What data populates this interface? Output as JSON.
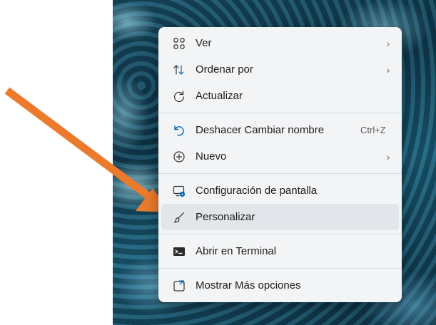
{
  "menu": {
    "items": [
      {
        "label": "Ver",
        "icon": "grid-icon",
        "submenu": true
      },
      {
        "label": "Ordenar por",
        "icon": "sort-icon",
        "submenu": true
      },
      {
        "label": "Actualizar",
        "icon": "refresh-icon"
      },
      {
        "label": "Deshacer Cambiar nombre",
        "icon": "undo-icon",
        "shortcut": "Ctrl+Z"
      },
      {
        "label": "Nuevo",
        "icon": "new-icon",
        "submenu": true
      },
      {
        "label": "Configuración de pantalla",
        "icon": "display-settings-icon"
      },
      {
        "label": "Personalizar",
        "icon": "brush-icon",
        "highlighted": true
      },
      {
        "label": "Abrir en Terminal",
        "icon": "terminal-icon"
      },
      {
        "label": "Mostrar Más opciones",
        "icon": "more-options-icon"
      }
    ],
    "chevron": "›"
  },
  "colors": {
    "accent": "#0067c0",
    "arrow": "#ec7a2c",
    "menu_bg": "#f3f4f6",
    "highlight": "#e2e5e9"
  }
}
